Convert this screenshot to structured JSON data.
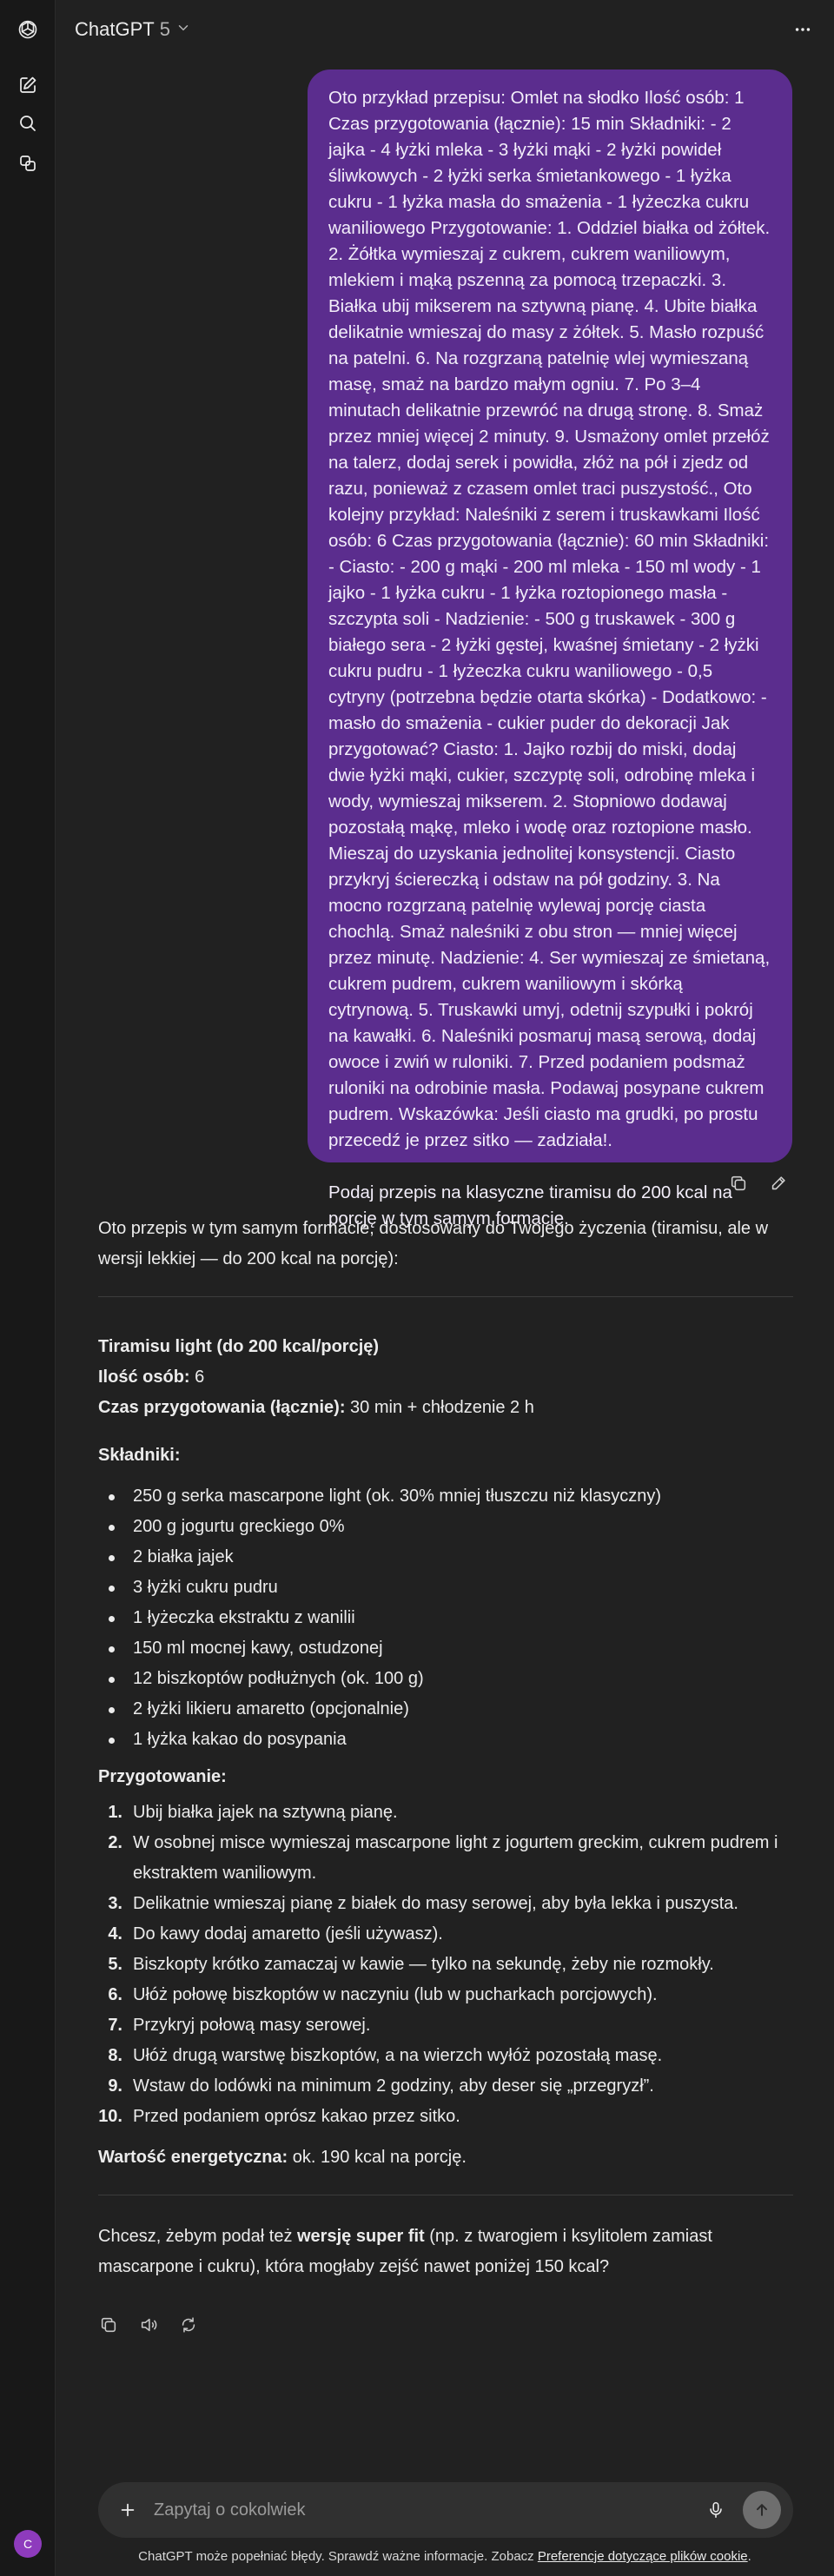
{
  "colors": {
    "background": "#212121",
    "sidebar": "#181818",
    "user_bubble": "#5b2d8e",
    "composer": "#303030",
    "avatar": "#8e3bbd"
  },
  "sidebar": {
    "icons": [
      "openai-logo-icon",
      "new-chat-icon",
      "search-icon",
      "library-icon"
    ],
    "avatar_letter": "C"
  },
  "header": {
    "model_name": "ChatGPT",
    "model_version": "5"
  },
  "user_message": {
    "text": "Oto przykład przepisu: Omlet na słodko Ilość osób: 1 Czas przygotowania (łącznie): 15 min Składniki: - 2 jajka - 4 łyżki mleka - 3 łyżki mąki - 2 łyżki powideł śliwkowych - 2 łyżki serka śmietankowego - 1 łyżka cukru - 1 łyżka masła do smażenia - 1 łyżeczka cukru waniliowego Przygotowanie: 1. Oddziel białka od żółtek. 2. Żółtka wymieszaj z cukrem, cukrem waniliowym, mlekiem i mąką pszenną za pomocą trzepaczki. 3. Białka ubij mikserem na sztywną pianę. 4. Ubite białka delikatnie wmieszaj do masy z żółtek. 5. Masło rozpuść na patelni. 6. Na rozgrzaną patelnię wlej wymieszaną masę, smaż na bardzo małym ogniu. 7. Po 3–4 minutach delikatnie przewróć na drugą stronę. 8. Smaż przez mniej więcej 2 minuty. 9. Usmażony omlet przełóż na talerz, dodaj serek i powidła, złóż na pół i zjedz od razu, ponieważ z czasem omlet traci puszystość., Oto kolejny przykład: Naleśniki z serem i truskawkami Ilość osób: 6 Czas przygotowania (łącznie): 60 min Składniki: - Ciasto: - 200 g mąki - 200 ml mleka - 150 ml wody - 1 jajko - 1 łyżka cukru - 1 łyżka roztopionego masła - szczypta soli - Nadzienie: - 500 g truskawek - 300 g białego sera - 2 łyżki gęstej, kwaśnej śmietany - 2 łyżki cukru pudru - 1 łyżeczka cukru waniliowego - 0,5 cytryny (potrzebna będzie otarta skórka) - Dodatkowo: - masło do smażenia - cukier puder do dekoracji Jak przygotować? Ciasto: 1. Jajko rozbij do miski, dodaj dwie łyżki mąki, cukier, szczyptę soli, odrobinę mleka i wody, wymieszaj mikserem. 2. Stopniowo dodawaj pozostałą mąkę, mleko i wodę oraz roztopione masło. Mieszaj do uzyskania jednolitej konsystencji. Ciasto przykryj ściereczką i odstaw na pół godziny. 3. Na mocno rozgrzaną patelnię wylewaj porcję ciasta chochlą. Smaż naleśniki z obu stron — mniej więcej przez minutę. Nadzienie: 4. Ser wymieszaj ze śmietaną, cukrem pudrem, cukrem waniliowym i skórką cytrynową. 5. Truskawki umyj, odetnij szypułki i pokrój na kawałki. 6. Naleśniki posmaruj masą serową, dodaj owoce i zwiń w ruloniki. 7. Przed podaniem podsmaż ruloniki na odrobinie masła. Podawaj posypane cukrem pudrem. Wskazówka: Jeśli ciasto ma grudki, po prostu przecedź je przez sitko — zadziała!.\n\nPodaj przepis na klasyczne tiramisu do 200 kcal na porcję w tym samym formacie."
  },
  "assistant": {
    "intro": "Oto przepis w tym samym formacie, dostosowany do Twojego życzenia (tiramisu, ale w wersji lekkiej — do 200 kcal na porcję):",
    "title": "Tiramisu light (do 200 kcal/porcję)",
    "servings_label": "Ilość osób:",
    "servings_value": " 6",
    "time_label": "Czas przygotowania (łącznie):",
    "time_value": " 30 min + chłodzenie 2 h",
    "ingredients_heading": "Składniki:",
    "ingredients": [
      "250 g serka mascarpone light (ok. 30% mniej tłuszczu niż klasyczny)",
      "200 g jogurtu greckiego 0%",
      "2 białka jajek",
      "3 łyżki cukru pudru",
      "1 łyżeczka ekstraktu z wanilii",
      "150 ml mocnej kawy, ostudzonej",
      "12 biszkoptów podłużnych (ok. 100 g)",
      "2 łyżki likieru amaretto (opcjonalnie)",
      "1 łyżka kakao do posypania"
    ],
    "steps_heading": "Przygotowanie:",
    "steps": [
      {
        "num": "1.",
        "text": "Ubij białka jajek na sztywną pianę."
      },
      {
        "num": "2.",
        "text": "W osobnej misce wymieszaj mascarpone light z jogurtem greckim, cukrem pudrem i ekstraktem waniliowym."
      },
      {
        "num": "3.",
        "text": "Delikatnie wmieszaj pianę z białek do masy serowej, aby była lekka i puszysta."
      },
      {
        "num": "4.",
        "text": "Do kawy dodaj amaretto (jeśli używasz)."
      },
      {
        "num": "5.",
        "text": "Biszkopty krótko zamaczaj w kawie — tylko na sekundę, żeby nie rozmokły."
      },
      {
        "num": "6.",
        "text": "Ułóż połowę biszkoptów w naczyniu (lub w pucharkach porcjowych)."
      },
      {
        "num": "7.",
        "text": "Przykryj połową masy serowej."
      },
      {
        "num": "8.",
        "text": "Ułóż drugą warstwę biszkoptów, a na wierzch wyłóż pozostałą masę."
      },
      {
        "num": "9.",
        "text": "Wstaw do lodówki na minimum 2 godziny, aby deser się „przegryzł”."
      },
      {
        "num": "10.",
        "text": "Przed podaniem oprósz kakao przez sitko."
      }
    ],
    "calories_label": "Wartość energetyczna:",
    "calories_value": " ok. 190 kcal na porcję.",
    "followup_before": "Chcesz, żebym podał też ",
    "followup_bold": "wersję super fit",
    "followup_after": " (np. z twarogiem i ksylitolem zamiast mascarpone i cukru), która mogłaby zejść nawet poniżej 150 kcal?"
  },
  "composer": {
    "placeholder": "Zapytaj o cokolwiek"
  },
  "footer": {
    "text": "ChatGPT może popełniać błędy. Sprawdź ważne informacje. Zobacz ",
    "link": "Preferencje dotyczące plików cookie",
    "end": "."
  }
}
